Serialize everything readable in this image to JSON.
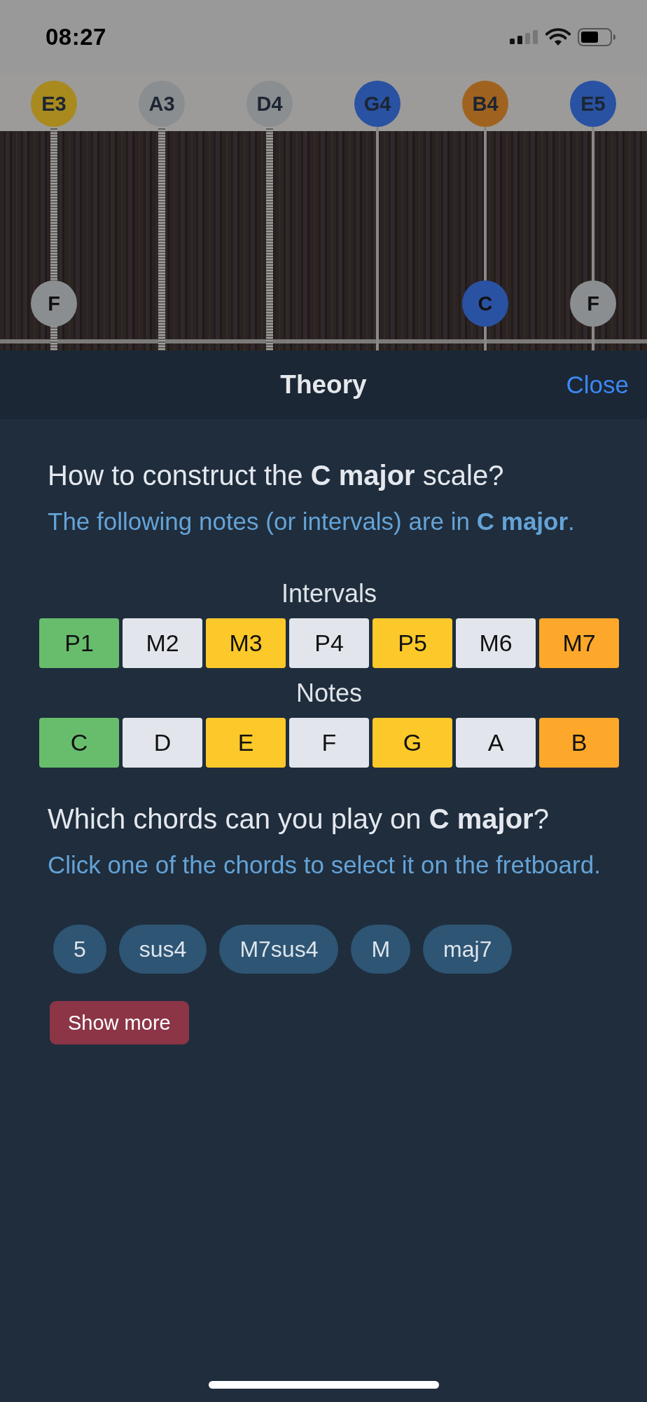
{
  "status_bar": {
    "time": "08:27"
  },
  "fretboard": {
    "strings": [
      {
        "label": "E3",
        "color": "#a88a1e",
        "wound": true,
        "marker": {
          "note": "F",
          "color": "#8b8e91"
        }
      },
      {
        "label": "A3",
        "color": "#8b8e91",
        "wound": true
      },
      {
        "label": "D4",
        "color": "#8b8e91",
        "wound": true
      },
      {
        "label": "G4",
        "color": "#2a52a3",
        "wound": false
      },
      {
        "label": "B4",
        "color": "#a0631f",
        "wound": false,
        "marker": {
          "note": "C",
          "color": "#2a52a3"
        }
      },
      {
        "label": "E5",
        "color": "#2a52a3",
        "wound": false,
        "marker": {
          "note": "F",
          "color": "#8b8e91"
        }
      }
    ]
  },
  "sheet": {
    "title": "Theory",
    "close": "Close"
  },
  "scale_section": {
    "heading": "How to construct the **C major** scale?",
    "subtitle": "The following notes (or intervals) are in **C major**.",
    "intervals_label": "Intervals",
    "intervals": [
      {
        "label": "P1",
        "color": "#68bd6c"
      },
      {
        "label": "M2",
        "color": "#e2e6ec"
      },
      {
        "label": "M3",
        "color": "#fdc92a"
      },
      {
        "label": "P4",
        "color": "#e2e6ec"
      },
      {
        "label": "P5",
        "color": "#fdc92a"
      },
      {
        "label": "M6",
        "color": "#e2e6ec"
      },
      {
        "label": "M7",
        "color": "#fda82a"
      }
    ],
    "notes_label": "Notes",
    "notes": [
      {
        "label": "C",
        "color": "#68bd6c"
      },
      {
        "label": "D",
        "color": "#e2e6ec"
      },
      {
        "label": "E",
        "color": "#fdc92a"
      },
      {
        "label": "F",
        "color": "#e2e6ec"
      },
      {
        "label": "G",
        "color": "#fdc92a"
      },
      {
        "label": "A",
        "color": "#e2e6ec"
      },
      {
        "label": "B",
        "color": "#fda82a"
      }
    ]
  },
  "chords_section": {
    "heading": "Which chords can you play on **C major**?",
    "subtitle": "Click one of the chords to select it on the fretboard.",
    "chords": [
      "5",
      "sus4",
      "M7sus4",
      "M",
      "maj7"
    ],
    "show_more": "Show more"
  }
}
